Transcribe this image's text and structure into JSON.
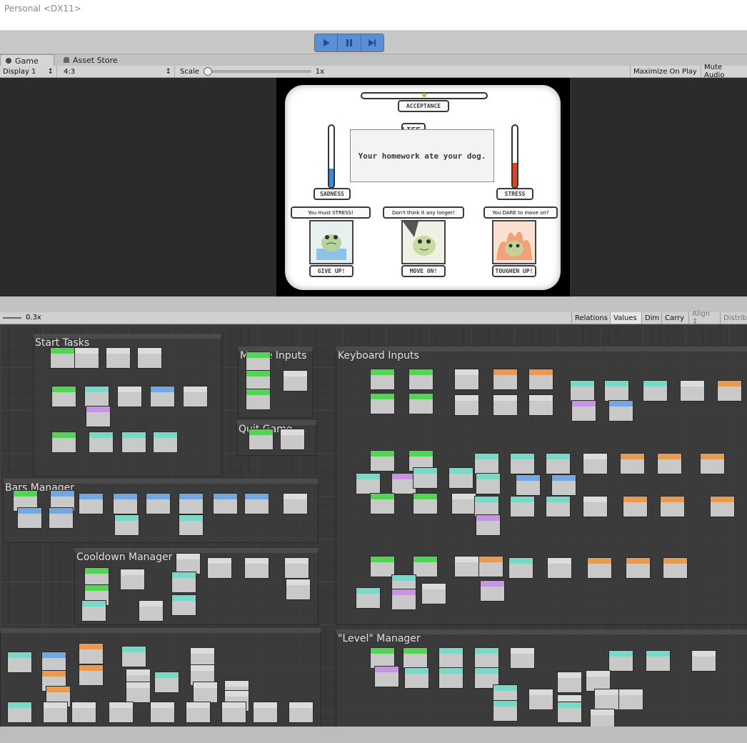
{
  "window": {
    "title": "Personal <DX11>"
  },
  "colors": {
    "play_blue": "#5b8fd4",
    "graph_bg": "#393939",
    "sadness_fill": "#3a8ad8",
    "stress_fill": "#d9452b"
  },
  "tabs": [
    {
      "label": "Game",
      "icon": "gamepad-icon"
    },
    {
      "label": "Asset Store",
      "icon": "store-icon"
    }
  ],
  "game_toolbar": {
    "display": "Display 1",
    "aspect": "4:3",
    "scale_label": "Scale",
    "scale_value": "1x",
    "maximize": "Maximize On Play",
    "mute": "Mute Audio"
  },
  "game": {
    "acceptance_label": "ACCEPTANCE",
    "acceptance_level": 0.5,
    "life_label": "LIFE:",
    "message": "Your homework ate your dog.",
    "sadness_label": "SADNESS",
    "sadness_level": 0.3,
    "stress_label": "STRESS",
    "stress_level": 0.4,
    "choices": [
      {
        "caption": "You must STRESS!",
        "action": "GIVE UP!"
      },
      {
        "caption": "Don't think it any longer!",
        "action": "MOVE ON!"
      },
      {
        "caption": "You DARE to move on?",
        "action": "TOUGHEN UP!"
      }
    ]
  },
  "graph_toolbar": {
    "zoom": "0.3x",
    "buttons": [
      "Relations",
      "Values",
      "Dim",
      "Carry",
      "Align ↕",
      "Distrib"
    ]
  },
  "groups": [
    {
      "title": "Start Tasks"
    },
    {
      "title": "Mouse Inputs"
    },
    {
      "title": "Quit Game"
    },
    {
      "title": "Keyboard Inputs"
    },
    {
      "title": "Bars Manager"
    },
    {
      "title": "Cooldown Manager"
    },
    {
      "title": "\"Level\" Manager"
    }
  ]
}
